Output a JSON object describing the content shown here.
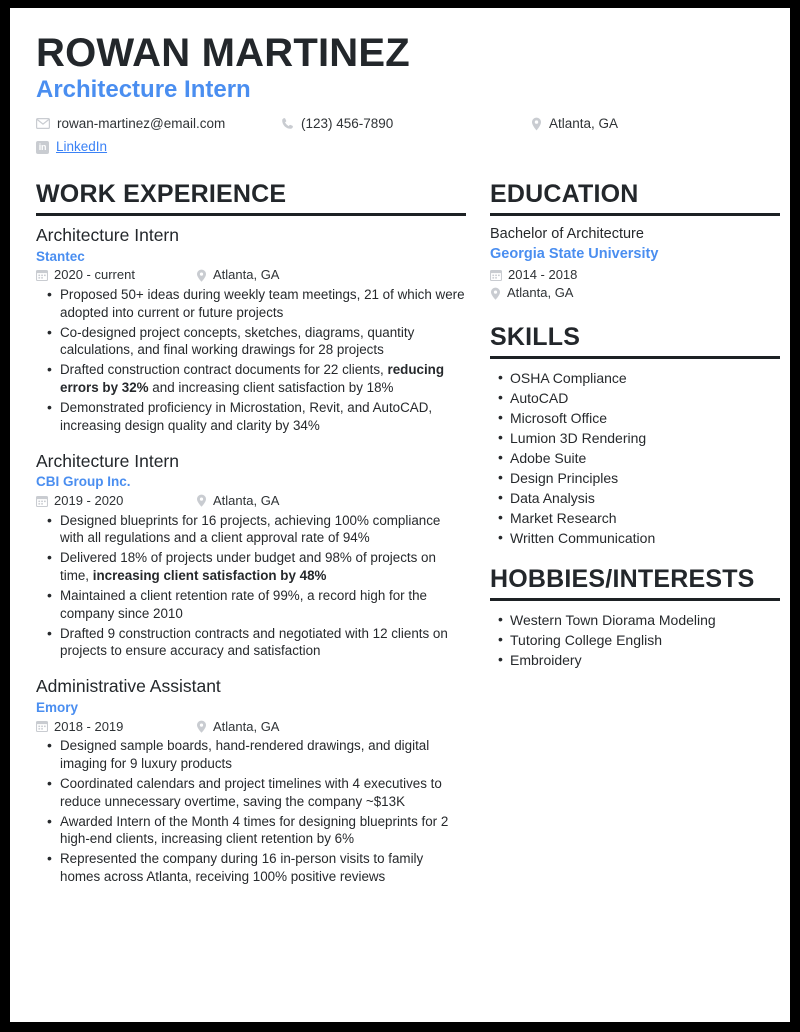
{
  "header": {
    "name": "ROWAN MARTINEZ",
    "job_title": "Architecture Intern",
    "contacts": {
      "email": "rowan-martinez@email.com",
      "phone": "(123) 456-7890",
      "location": "Atlanta, GA",
      "linkedin_label": "LinkedIn"
    },
    "icons": {
      "email": "envelope-icon",
      "phone": "phone-icon",
      "location": "map-pin-icon",
      "linkedin": "linkedin-icon"
    }
  },
  "colors": {
    "accent_blue": "#4a8ef0",
    "link_blue": "#3b82f6",
    "heading_dark": "#23272b",
    "body_text": "#26292c",
    "icon_gray": "#c9ccd1",
    "page_border": "#000000"
  },
  "work_experience": {
    "section_title": "WORK EXPERIENCE",
    "entries": [
      {
        "title": "Architecture Intern",
        "org": "Stantec",
        "dates": "2020 - current",
        "location": "Atlanta, GA",
        "bullets": [
          {
            "parts": [
              {
                "text": "Proposed 50+ ideas during weekly team meetings, 21 of which were adopted into current or future projects",
                "bold": false
              }
            ]
          },
          {
            "parts": [
              {
                "text": "Co-designed project concepts, sketches, diagrams, quantity calculations, and final working drawings for 28 projects",
                "bold": false
              }
            ]
          },
          {
            "parts": [
              {
                "text": "Drafted construction contract documents for 22 clients, ",
                "bold": false
              },
              {
                "text": "reducing errors by 32%",
                "bold": true
              },
              {
                "text": " and increasing client satisfaction by 18%",
                "bold": false
              }
            ]
          },
          {
            "parts": [
              {
                "text": "Demonstrated proficiency in Microstation, Revit, and AutoCAD, increasing design quality and clarity by 34%",
                "bold": false
              }
            ]
          }
        ]
      },
      {
        "title": "Architecture Intern",
        "org": "CBI Group Inc.",
        "dates": "2019 - 2020",
        "location": "Atlanta, GA",
        "bullets": [
          {
            "parts": [
              {
                "text": "Designed blueprints for 16 projects, achieving 100% compliance with all regulations and a client approval rate of 94%",
                "bold": false
              }
            ]
          },
          {
            "parts": [
              {
                "text": "Delivered 18% of projects under budget and 98% of projects on time, ",
                "bold": false
              },
              {
                "text": "increasing client satisfaction by 48%",
                "bold": true
              }
            ]
          },
          {
            "parts": [
              {
                "text": "Maintained a client retention rate of 99%, a record high for the company since 2010",
                "bold": false
              }
            ]
          },
          {
            "parts": [
              {
                "text": "Drafted 9 construction contracts and negotiated with 12 clients on projects to ensure accuracy and satisfaction",
                "bold": false
              }
            ]
          }
        ]
      },
      {
        "title": "Administrative Assistant",
        "org": "Emory",
        "dates": "2018 - 2019",
        "location": "Atlanta, GA",
        "bullets": [
          {
            "parts": [
              {
                "text": "Designed sample boards, hand-rendered drawings, and digital imaging for 9 luxury products",
                "bold": false
              }
            ]
          },
          {
            "parts": [
              {
                "text": "Coordinated calendars and project timelines with 4 executives to reduce unnecessary overtime, saving the company ~$13K",
                "bold": false
              }
            ]
          },
          {
            "parts": [
              {
                "text": "Awarded Intern of the Month 4 times for designing blueprints for 2 high-end clients, increasing client retention by 6%",
                "bold": false
              }
            ]
          },
          {
            "parts": [
              {
                "text": "Represented the company during 16 in-person visits to family homes across Atlanta, receiving 100% positive reviews",
                "bold": false
              }
            ]
          }
        ]
      }
    ]
  },
  "education": {
    "section_title": "EDUCATION",
    "degree": "Bachelor of Architecture",
    "school": "Georgia State University",
    "dates": "2014 - 2018",
    "location": "Atlanta, GA"
  },
  "skills": {
    "section_title": "SKILLS",
    "items": [
      "OSHA Compliance",
      "AutoCAD",
      "Microsoft Office",
      "Lumion 3D Rendering",
      "Adobe Suite",
      "Design Principles",
      "Data Analysis",
      "Market Research",
      "Written Communication"
    ]
  },
  "hobbies": {
    "section_title": "HOBBIES/INTERESTS",
    "items": [
      "Western Town Diorama Modeling",
      "Tutoring College English",
      "Embroidery"
    ]
  }
}
